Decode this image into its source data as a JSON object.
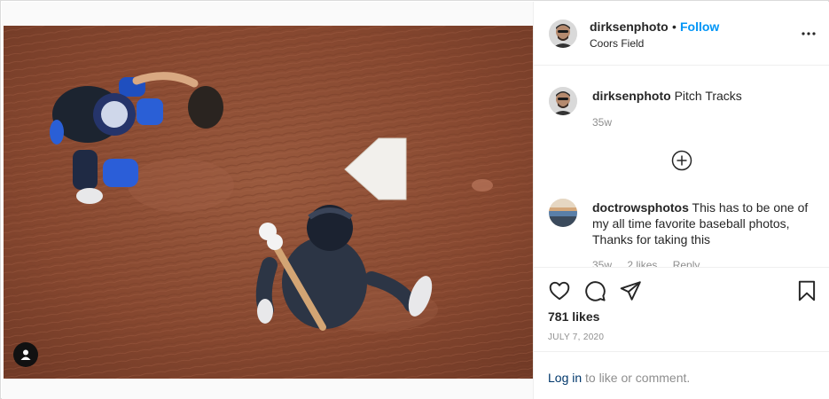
{
  "post": {
    "username": "dirksenphoto",
    "dot": "•",
    "follow_label": "Follow",
    "location": "Coors Field",
    "more_icon": "more-horizontal-icon"
  },
  "comments": [
    {
      "username": "dirksenphoto",
      "text": "Pitch Tracks",
      "age": "35w"
    },
    {
      "username": "doctrowsphotos",
      "text": "This has to be one of my all time favorite baseball photos, Thanks for taking this",
      "age": "35w",
      "likes": "2 likes",
      "reply": "Reply"
    }
  ],
  "load_more_icon": "plus-circle-icon",
  "actions": {
    "like_icon": "heart-icon",
    "comment_icon": "comment-icon",
    "share_icon": "share-icon",
    "save_icon": "bookmark-icon"
  },
  "likes_text": "781 likes",
  "date_text": "JULY 7, 2020",
  "login": {
    "link": "Log in",
    "rest": "to like or comment."
  },
  "colors": {
    "accent": "#0095f6",
    "dirt": "#8a4a33",
    "muted": "#8e8e8e"
  }
}
